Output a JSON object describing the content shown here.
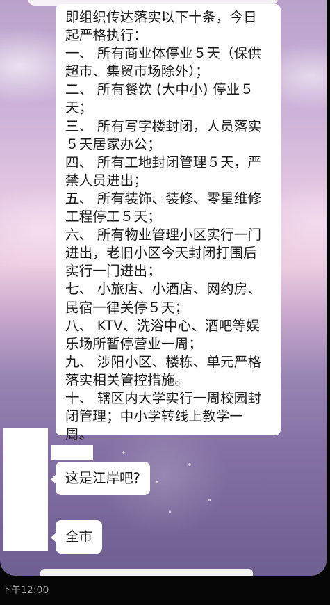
{
  "message": {
    "lines": [
      "即组织传达落实以下十条，今日",
      "起严格执行：",
      "一、 所有商业体停业５天（保供",
      "超市、集贸市场除外）；",
      "二、 所有餐饮 (大中小) 停业５",
      "天；",
      "三、 所有写字楼封闭，人员落实",
      "５天居家办公；",
      "四、 所有工地封闭管理５天，严",
      "禁人员进出；",
      "五、 所有装饰、装修、零星维修",
      "工程停工５天；",
      "六、 所有物业管理小区实行一门",
      "进出，老旧小区今天封闭打围后",
      "实行一门进出；",
      "七、 小旅店、小酒店、网约房、",
      "民宿一律关停５天；",
      "八、 KTV、洗浴中心、酒吧等娱",
      "乐场所暂停营业一周；",
      "九、 涉阳小区、楼栋、单元严格",
      "落实相关管控措施。",
      "十、 辖区内大学实行一周校园封",
      "闭管理；中小学转线上教学一",
      "周。"
    ]
  },
  "replies": [
    {
      "text": "这是江岸吧?"
    },
    {
      "text": "全市"
    }
  ],
  "footer": {
    "timestamp": "下午12:00"
  },
  "colors": {
    "bubble": "#ffffff",
    "background_top": "#b9a2cb",
    "background_bottom": "#6e5f91"
  }
}
